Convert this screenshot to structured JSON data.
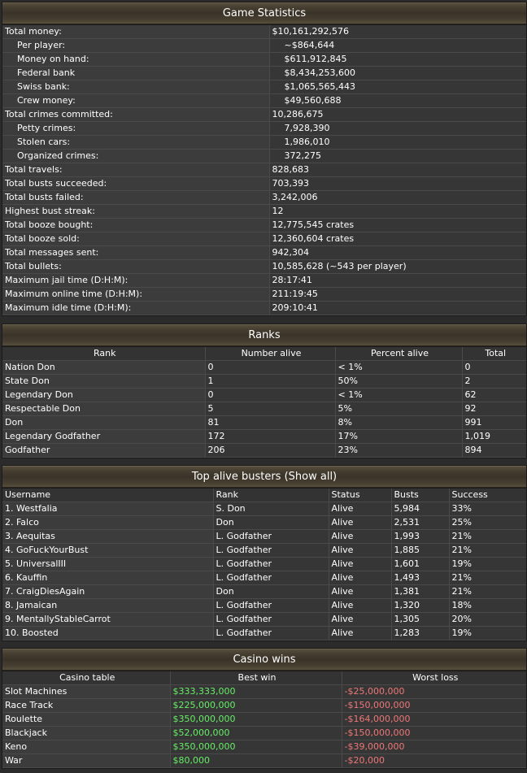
{
  "game_stats": {
    "title": "Game Statistics",
    "rows": [
      {
        "label": "Total money:",
        "value": "$10,161,292,576",
        "indent": false
      },
      {
        "label": "Per player:",
        "value": "~$864,644",
        "indent": true
      },
      {
        "label": "Money on hand:",
        "value": "$611,912,845",
        "indent": true
      },
      {
        "label": "Federal bank",
        "value": "$8,434,253,600",
        "indent": true
      },
      {
        "label": "Swiss bank:",
        "value": "$1,065,565,443",
        "indent": true
      },
      {
        "label": "Crew money:",
        "value": "$49,560,688",
        "indent": true
      },
      {
        "label": "Total crimes committed:",
        "value": "10,286,675",
        "indent": false
      },
      {
        "label": "Petty crimes:",
        "value": "7,928,390",
        "indent": true
      },
      {
        "label": "Stolen cars:",
        "value": "1,986,010",
        "indent": true
      },
      {
        "label": "Organized crimes:",
        "value": "372,275",
        "indent": true
      },
      {
        "label": "Total travels:",
        "value": "828,683",
        "indent": false
      },
      {
        "label": "Total busts succeeded:",
        "value": "703,393",
        "indent": false
      },
      {
        "label": "Total busts failed:",
        "value": "3,242,006",
        "indent": false
      },
      {
        "label": "Highest bust streak:",
        "value": "12",
        "indent": false
      },
      {
        "label": "Total booze bought:",
        "value": "12,775,545 crates",
        "indent": false
      },
      {
        "label": "Total booze sold:",
        "value": "12,360,604 crates",
        "indent": false
      },
      {
        "label": "Total messages sent:",
        "value": "942,304",
        "indent": false
      },
      {
        "label": "Total bullets:",
        "value": "10,585,628 (~543 per player)",
        "indent": false
      },
      {
        "label": "Maximum jail time (D:H:M):",
        "value": "28:17:41",
        "indent": false
      },
      {
        "label": "Maximum online time (D:H:M):",
        "value": "211:19:45",
        "indent": false
      },
      {
        "label": "Maximum idle time (D:H:M):",
        "value": "209:10:41",
        "indent": false
      }
    ]
  },
  "ranks": {
    "title": "Ranks",
    "headers": [
      "Rank",
      "Number alive",
      "Percent alive",
      "Total"
    ],
    "rows": [
      [
        "Nation Don",
        "0",
        "< 1%",
        "0"
      ],
      [
        "State Don",
        "1",
        "50%",
        "2"
      ],
      [
        "Legendary Don",
        "0",
        "< 1%",
        "62"
      ],
      [
        "Respectable Don",
        "5",
        "5%",
        "92"
      ],
      [
        "Don",
        "81",
        "8%",
        "991"
      ],
      [
        "Legendary Godfather",
        "172",
        "17%",
        "1,019"
      ],
      [
        "Godfather",
        "206",
        "23%",
        "894"
      ]
    ]
  },
  "busters": {
    "title": "Top alive busters",
    "show_all": "(Show all)",
    "headers": [
      "Username",
      "Rank",
      "Status",
      "Busts",
      "Success"
    ],
    "rows": [
      [
        "1. Westfalia",
        "S. Don",
        "Alive",
        "5,984",
        "33%"
      ],
      [
        "2. Falco",
        "Don",
        "Alive",
        "2,531",
        "25%"
      ],
      [
        "3. Aequitas",
        "L. Godfather",
        "Alive",
        "1,993",
        "21%"
      ],
      [
        "4. GoFuckYourBust",
        "L. Godfather",
        "Alive",
        "1,885",
        "21%"
      ],
      [
        "5. UniversalIII",
        "L. Godfather",
        "Alive",
        "1,601",
        "19%"
      ],
      [
        "6. Kauffin",
        "L. Godfather",
        "Alive",
        "1,493",
        "21%"
      ],
      [
        "7. CraigDiesAgain",
        "Don",
        "Alive",
        "1,381",
        "21%"
      ],
      [
        "8. Jamaican",
        "L. Godfather",
        "Alive",
        "1,320",
        "18%"
      ],
      [
        "9. MentallyStableCarrot",
        "L. Godfather",
        "Alive",
        "1,305",
        "20%"
      ],
      [
        "10. Boosted",
        "L. Godfather",
        "Alive",
        "1,283",
        "19%"
      ]
    ]
  },
  "casino": {
    "title": "Casino wins",
    "headers": [
      "Casino table",
      "Best win",
      "Worst loss"
    ],
    "rows": [
      [
        "Slot Machines",
        "$333,333,000",
        "-$25,000,000"
      ],
      [
        "Race Track",
        "$225,000,000",
        "-$150,000,000"
      ],
      [
        "Roulette",
        "$350,000,000",
        "-$164,000,000"
      ],
      [
        "Blackjack",
        "$52,000,000",
        "-$150,000,000"
      ],
      [
        "Keno",
        "$350,000,000",
        "-$39,000,000"
      ],
      [
        "War",
        "$80,000",
        "-$20,000"
      ]
    ]
  },
  "colors": {
    "win": "#66ee66",
    "loss": "#ee7777"
  }
}
